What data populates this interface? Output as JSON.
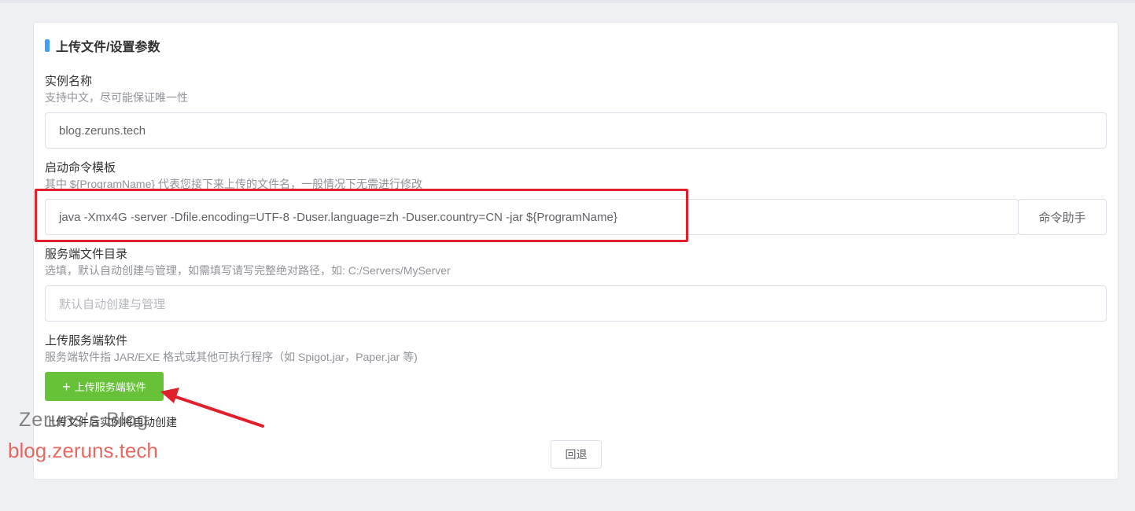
{
  "card": {
    "title": "上传文件/设置参数"
  },
  "instance_name": {
    "label": "实例名称",
    "desc": "支持中文，尽可能保证唯一性",
    "value": "blog.zeruns.tech"
  },
  "start_command": {
    "label": "启动命令模板",
    "desc": "其中 ${ProgramName} 代表您接下来上传的文件名，一般情况下无需进行修改",
    "value": "java -Xmx4G -server -Dfile.encoding=UTF-8 -Duser.language=zh -Duser.country=CN -jar ${ProgramName}",
    "helper_button": "命令助手"
  },
  "server_dir": {
    "label": "服务端文件目录",
    "desc": "选填，默认自动创建与管理，如需填写请写完整绝对路径，如: C:/Servers/MyServer",
    "placeholder": "默认自动创建与管理"
  },
  "upload": {
    "label": "上传服务端软件",
    "desc": "服务端软件指 JAR/EXE 格式或其他可执行程序（如 Spigot.jar，Paper.jar 等)",
    "button_icon": "+",
    "button": "上传服务端软件",
    "note": "上传文件后实例将自动创建"
  },
  "back_button": "回退",
  "watermark": {
    "line1": "Zeruns's Blog",
    "line2": "blog.zeruns.tech"
  },
  "colors": {
    "accent": "#409eff",
    "success": "#67c23a",
    "annotation": "#e0212b"
  }
}
